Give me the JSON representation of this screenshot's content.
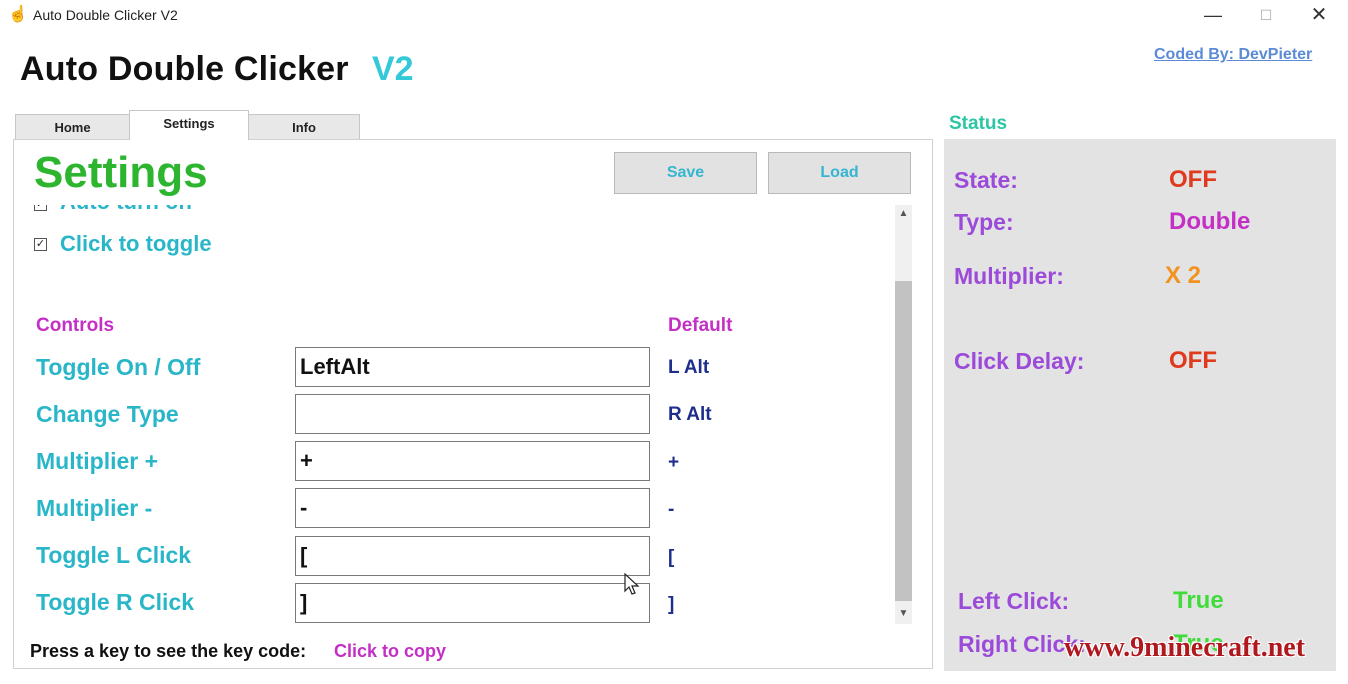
{
  "window": {
    "title": "Auto Double Clicker V2",
    "minimize": "—",
    "maximize": "☐",
    "close": "✕"
  },
  "header": {
    "title": "Auto Double Clicker",
    "version": "V2",
    "coded_by": "Coded By: DevPieter"
  },
  "tabs": [
    {
      "label": "Home"
    },
    {
      "label": "Settings"
    },
    {
      "label": "Info"
    }
  ],
  "settings": {
    "heading": "Settings",
    "save_label": "Save",
    "load_label": "Load",
    "checkboxes": [
      {
        "label": "Auto turn on",
        "checked": true
      },
      {
        "label": "Click to toggle",
        "checked": true
      }
    ],
    "controls_header": "Controls",
    "default_header": "Default",
    "controls": [
      {
        "label": "Toggle On / Off",
        "value": "LeftAlt",
        "default": "L Alt"
      },
      {
        "label": "Change Type",
        "value": "",
        "default": "R Alt"
      },
      {
        "label": "Multiplier +",
        "value": "+",
        "default": "+"
      },
      {
        "label": "Multiplier -",
        "value": "-",
        "default": "-"
      },
      {
        "label": "Toggle L Click",
        "value": "[",
        "default": "["
      },
      {
        "label": "Toggle R Click",
        "value": "]",
        "default": "]"
      }
    ],
    "keycode_prompt": "Press a key to see the key code:",
    "click_to_copy": "Click to copy"
  },
  "status": {
    "title": "Status",
    "state_label": "State:",
    "state_value": "OFF",
    "type_label": "Type:",
    "type_value": "Double",
    "multiplier_label": "Multiplier:",
    "multiplier_value": "X 2",
    "delay_label": "Click Delay:",
    "delay_value": "OFF",
    "left_label": "Left Click:",
    "left_value": "True",
    "right_label": "Right Click:",
    "right_value": "True"
  },
  "colors": {
    "off": "#e03a1e",
    "type": "#c42fc5",
    "multiplier": "#f2921f",
    "true": "#3fdc3c"
  },
  "watermark": "www.9minecraft.net",
  "icons": {
    "app": "hand-pointer-icon",
    "cursor": "mouse-pointer-icon"
  }
}
